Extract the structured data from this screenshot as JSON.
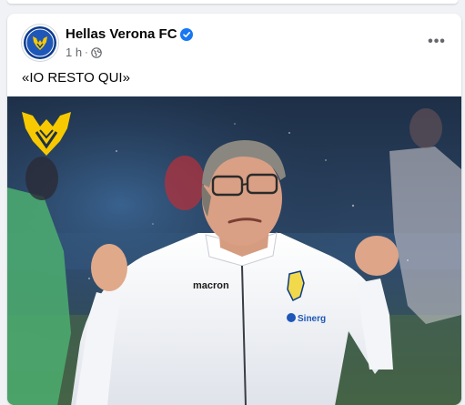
{
  "post": {
    "page_name": "Hellas Verona FC",
    "time": "1 h",
    "separator": "·",
    "text": "«IO RESTO QUI»",
    "more_label": "•••"
  },
  "jersey": {
    "brand": "macron",
    "sponsor": "Sinerg"
  },
  "icons": {
    "verified": "verified-badge-icon",
    "audience": "globe-icon",
    "more": "more-options-icon"
  },
  "colors": {
    "brand_yellow": "#f6c900",
    "brand_blue": "#0b3a8c",
    "verified_blue": "#1877f2",
    "text_primary": "#050505",
    "text_secondary": "#65676b"
  }
}
